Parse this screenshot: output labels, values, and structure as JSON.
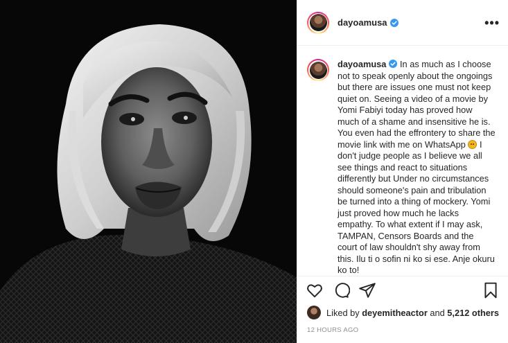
{
  "post": {
    "username": "dayoamusa",
    "caption_text": " In as much as I choose not to speak openly about the ongoings but there are issues one must not keep quiet on. Seeing a video of a movie by Yomi Fabiyi today has proved how much of a shame and insensitive he is. You even had the effrontery to share the movie link with me on WhatsApp ",
    "caption_text_2": " I don't judge people as I believe we all see things and react to situations differently but Under no circumstances should someone's pain and tribulation be turned into a thing of mockery. Yomi just proved how much he lacks empathy. To what extent if I may ask, TAMPAN, Censors Boards and the court of law shouldn't shy away from this. Ilu ti o sofin ni ko si ese. Anje okuru ko to!",
    "more_symbol": "•••",
    "liked_by_prefix": "Liked by ",
    "liked_by_user": "deyemitheactor",
    "liked_by_suffix": " and ",
    "liked_by_others": "5,212 others",
    "timestamp": "12 HOURS AGO"
  },
  "icons": {
    "verified": "verified-badge-icon",
    "like": "heart-icon",
    "comment": "comment-icon",
    "share": "paper-plane-icon",
    "save": "bookmark-icon",
    "more": "more-options-icon",
    "emoji": "angry-face-emoji"
  },
  "colors": {
    "verified": "#3897f0",
    "text": "#262626",
    "muted": "#8e8e8e",
    "divider": "#efefef",
    "photo_bg": "#0a0a0a"
  }
}
